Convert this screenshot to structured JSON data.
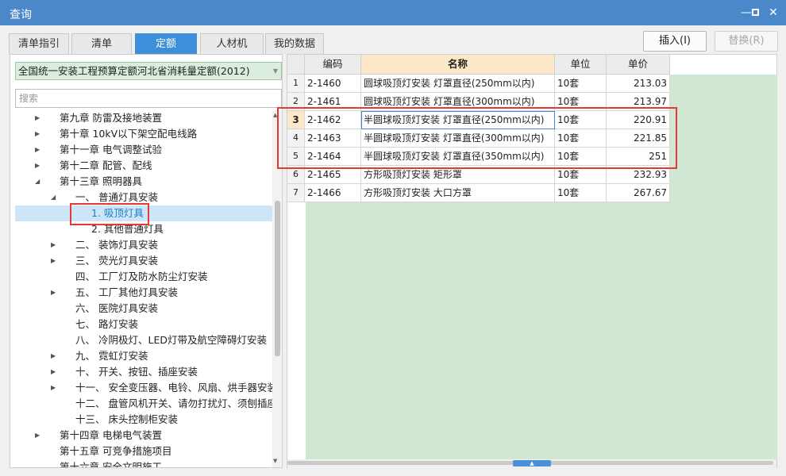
{
  "window": {
    "title": "查询"
  },
  "tabs": [
    {
      "label": "清单指引"
    },
    {
      "label": "清单"
    },
    {
      "label": "定额",
      "active": true
    },
    {
      "label": "人材机"
    },
    {
      "label": "我的数据"
    }
  ],
  "actions": {
    "insert": "插入(I)",
    "replace": "替换(R)"
  },
  "library": {
    "selected": "全国统一安装工程预算定额河北省消耗量定额(2012)"
  },
  "search": {
    "placeholder": "搜索"
  },
  "tree": [
    {
      "label": "第九章 防雷及接地装置",
      "level": 0,
      "expander": "collapsed"
    },
    {
      "label": "第十章 10kV以下架空配电线路",
      "level": 0,
      "expander": "collapsed"
    },
    {
      "label": "第十一章 电气调整试验",
      "level": 0,
      "expander": "collapsed"
    },
    {
      "label": "第十二章 配管、配线",
      "level": 0,
      "expander": "collapsed"
    },
    {
      "label": "第十三章 照明器具",
      "level": 0,
      "expander": "expanded"
    },
    {
      "label": "一、 普通灯具安装",
      "level": 1,
      "expander": "expanded"
    },
    {
      "label": "1. 吸顶灯具",
      "level": 2,
      "expander": "none",
      "selected": true
    },
    {
      "label": "2. 其他普通灯具",
      "level": 2,
      "expander": "none"
    },
    {
      "label": "二、 装饰灯具安装",
      "level": 1,
      "expander": "collapsed"
    },
    {
      "label": "三、 荧光灯具安装",
      "level": 1,
      "expander": "collapsed"
    },
    {
      "label": "四、 工厂灯及防水防尘灯安装",
      "level": 1,
      "expander": "none"
    },
    {
      "label": "五、 工厂其他灯具安装",
      "level": 1,
      "expander": "collapsed"
    },
    {
      "label": "六、 医院灯具安装",
      "level": 1,
      "expander": "none"
    },
    {
      "label": "七、 路灯安装",
      "level": 1,
      "expander": "none"
    },
    {
      "label": "八、 冷阴极灯、LED灯带及航空障碍灯安装",
      "level": 1,
      "expander": "none"
    },
    {
      "label": "九、 霓虹灯安装",
      "level": 1,
      "expander": "collapsed"
    },
    {
      "label": "十、 开关、按钮、插座安装",
      "level": 1,
      "expander": "collapsed"
    },
    {
      "label": "十一、 安全变压器、电铃、风扇、烘手器安装",
      "level": 1,
      "expander": "collapsed"
    },
    {
      "label": "十二、 盘管风机开关、请勿打扰灯、须刨插座...",
      "level": 1,
      "expander": "none"
    },
    {
      "label": "十三、 床头控制柜安装",
      "level": 1,
      "expander": "none"
    },
    {
      "label": "第十四章 电梯电气装置",
      "level": 0,
      "expander": "collapsed"
    },
    {
      "label": "第十五章 可竞争措施项目",
      "level": 0,
      "expander": "none"
    },
    {
      "label": "第十六章 安全文明施工",
      "level": 0,
      "expander": "none"
    }
  ],
  "grid": {
    "columns": [
      {
        "label": ""
      },
      {
        "label": "编码"
      },
      {
        "label": "名称",
        "active": true
      },
      {
        "label": "单位"
      },
      {
        "label": "单价"
      }
    ],
    "rows": [
      {
        "n": "1",
        "code": "2-1460",
        "name": "圆球吸顶灯安装 灯罩直径(250mm以内)",
        "unit": "10套",
        "price": "213.03"
      },
      {
        "n": "2",
        "code": "2-1461",
        "name": "圆球吸顶灯安装 灯罩直径(300mm以内)",
        "unit": "10套",
        "price": "213.97"
      },
      {
        "n": "3",
        "code": "2-1462",
        "name": "半圆球吸顶灯安装 灯罩直径(250mm以内)",
        "unit": "10套",
        "price": "220.91",
        "current": true
      },
      {
        "n": "4",
        "code": "2-1463",
        "name": "半圆球吸顶灯安装 灯罩直径(300mm以内)",
        "unit": "10套",
        "price": "221.85"
      },
      {
        "n": "5",
        "code": "2-1464",
        "name": "半圆球吸顶灯安装 灯罩直径(350mm以内)",
        "unit": "10套",
        "price": "251"
      },
      {
        "n": "6",
        "code": "2-1465",
        "name": "方形吸顶灯安装 矩形罩",
        "unit": "10套",
        "price": "232.93"
      },
      {
        "n": "7",
        "code": "2-1466",
        "name": "方形吸顶灯安装 大口方罩",
        "unit": "10套",
        "price": "267.67"
      }
    ]
  },
  "icons": {
    "minimize": "—",
    "maximize": "box-outline",
    "close": "✕",
    "dropdown": "▼",
    "expanded": "◢",
    "collapsed": "▶",
    "scroll_up": "▲",
    "scroll_down": "▼",
    "hscroll_handle": "▲"
  },
  "colors": {
    "titlebar": "#4a88c9",
    "tab_active": "#3c8fd8",
    "highlight_box": "#e53935",
    "selection": "#cde6f7",
    "grid_background": "#cfe7d3"
  }
}
